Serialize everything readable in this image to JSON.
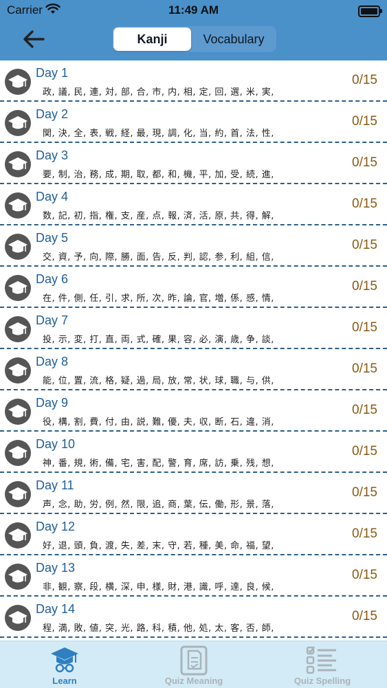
{
  "status": {
    "carrier": "Carrier",
    "time": "11:49 AM"
  },
  "segments": {
    "kanji": "Kanji",
    "vocabulary": "Vocabulary"
  },
  "rows": [
    {
      "title": "Day 1",
      "kanji": "政, 議, 民, 連, 対, 部, 合, 市, 内, 相, 定, 回, 選, 米, 実,",
      "progress": "0/15"
    },
    {
      "title": "Day 2",
      "kanji": "関, 決, 全, 表, 戦, 経, 最, 現, 調, 化, 当, 約, 首, 法, 性,",
      "progress": "0/15"
    },
    {
      "title": "Day 3",
      "kanji": "要, 制, 治, 務, 成, 期, 取, 都, 和, 機, 平, 加, 受, 続, 進,",
      "progress": "0/15"
    },
    {
      "title": "Day 4",
      "kanji": "数, 記, 初, 指, 権, 支, 産, 点, 報, 済, 活, 原, 共, 得, 解,",
      "progress": "0/15"
    },
    {
      "title": "Day 5",
      "kanji": "交, 資, 予, 向, 際, 勝, 面, 告, 反, 判, 認, 参, 利, 組, 信,",
      "progress": "0/15"
    },
    {
      "title": "Day 6",
      "kanji": "在, 件, 側, 任, 引, 求, 所, 次, 昨, 論, 官, 増, 係, 感, 情,",
      "progress": "0/15"
    },
    {
      "title": "Day 7",
      "kanji": "投, 示, 変, 打, 直, 両, 式, 確, 果, 容, 必, 演, 歳, 争, 談,",
      "progress": "0/15"
    },
    {
      "title": "Day 8",
      "kanji": "能, 位, 置, 流, 格, 疑, 過, 局, 放, 常, 状, 球, 職, 与, 供,",
      "progress": "0/15"
    },
    {
      "title": "Day 9",
      "kanji": "役, 構, 割, 費, 付, 由, 説, 難, 優, 夫, 収, 断, 石, 違, 消,",
      "progress": "0/15"
    },
    {
      "title": "Day 10",
      "kanji": "神, 番, 規, 術, 備, 宅, 害, 配, 警, 育, 席, 訪, 乗, 残, 想,",
      "progress": "0/15"
    },
    {
      "title": "Day 11",
      "kanji": "声, 念, 助, 労, 例, 然, 限, 追, 商, 葉, 伝, 働, 形, 景, 落,",
      "progress": "0/15"
    },
    {
      "title": "Day 12",
      "kanji": "好, 退, 頭, 負, 渡, 失, 差, 末, 守, 若, 種, 美, 命, 福, 望,",
      "progress": "0/15"
    },
    {
      "title": "Day 13",
      "kanji": "非, 観, 察, 段, 横, 深, 申, 様, 財, 港, 識, 呼, 達, 良, 候,",
      "progress": "0/15"
    },
    {
      "title": "Day 14",
      "kanji": "程, 満, 敗, 値, 突, 光, 路, 科, 積, 他, 処, 太, 客, 否, 師,",
      "progress": "0/15"
    }
  ],
  "tabs": [
    {
      "label": "Learn",
      "icon": "graduation-icon"
    },
    {
      "label": "Quiz Meaning",
      "icon": "quiz-document-icon"
    },
    {
      "label": "Quiz Spelling",
      "icon": "checklist-icon"
    }
  ],
  "colors": {
    "header": "#4a90c9",
    "title": "#1f5f9a",
    "progress": "#8a5a10",
    "tabbar": "#d3ebf6",
    "tab_active": "#2f7fc1"
  }
}
